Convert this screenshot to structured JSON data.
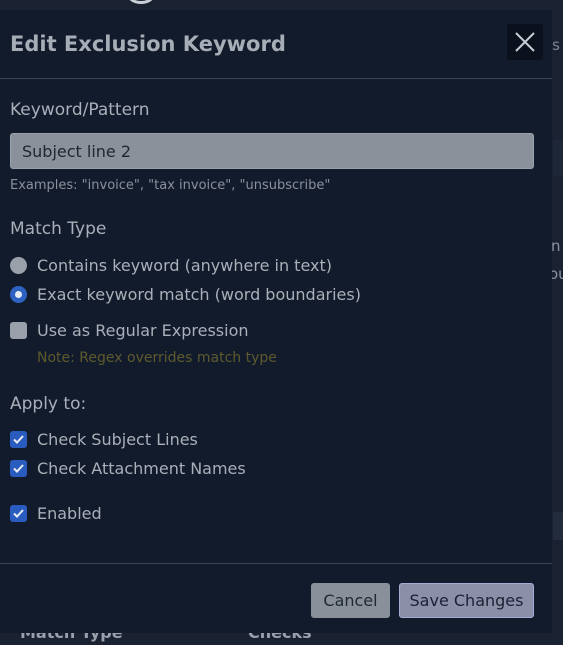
{
  "background": {
    "frag_ls": "ls",
    "frag_n": "n",
    "frag_ou": "ou",
    "bottom_left": "Match Type",
    "bottom_right": "Checks"
  },
  "modal": {
    "title": "Edit Exclusion Keyword",
    "close_icon": "close-icon"
  },
  "keyword": {
    "label": "Keyword/Pattern",
    "value": "Subject line 2",
    "examples": "Examples: \"invoice\", \"tax invoice\", \"unsubscribe\""
  },
  "match_type": {
    "label": "Match Type",
    "options": [
      {
        "label": "Contains keyword (anywhere in text)",
        "selected": false
      },
      {
        "label": "Exact keyword match (word boundaries)",
        "selected": true
      }
    ],
    "regex_label": "Use as Regular Expression",
    "regex_checked": false,
    "regex_note": "Note: Regex overrides match type"
  },
  "apply_to": {
    "label": "Apply to:",
    "subject_label": "Check Subject Lines",
    "subject_checked": true,
    "attachment_label": "Check Attachment Names",
    "attachment_checked": true
  },
  "enabled": {
    "label": "Enabled",
    "checked": true
  },
  "footer": {
    "cancel_label": "Cancel",
    "save_label": "Save Changes"
  },
  "colors": {
    "accent": "#2e62c2",
    "modal_bg": "#121b2b",
    "note": "#5e5a2e"
  }
}
